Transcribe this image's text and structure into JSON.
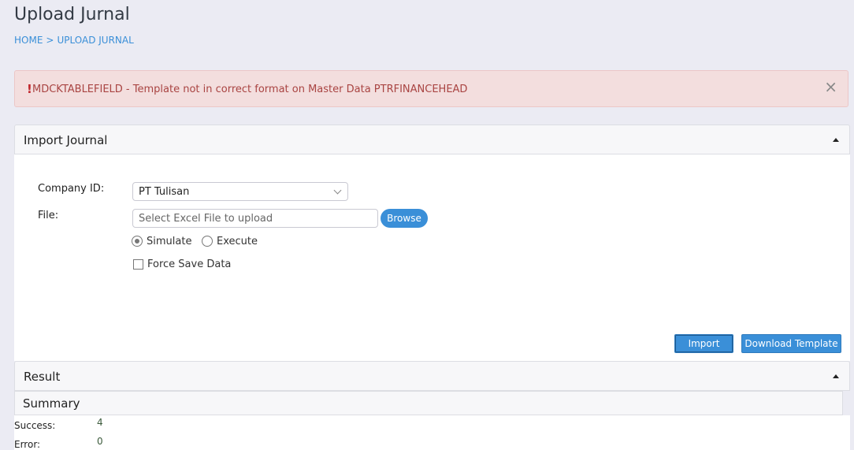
{
  "page": {
    "title": "Upload Jurnal",
    "breadcrumb": {
      "home": "HOME",
      "separator": ">",
      "current": "UPLOAD JURNAL"
    }
  },
  "alert": {
    "icon": "exclamation-icon",
    "mark": "!",
    "message": "MDCKTABLEFIELD - Template not in correct format on Master Data PTRFINANCEHEAD",
    "close": "×"
  },
  "import_panel": {
    "title": "Import Journal",
    "company_label": "Company ID:",
    "company_value": "PT Tulisan",
    "file_label": "File:",
    "file_placeholder": "Select Excel File to upload",
    "browse_label": "Browse",
    "mode_options": [
      {
        "label": "Simulate",
        "selected": true
      },
      {
        "label": "Execute",
        "selected": false
      }
    ],
    "force_save_label": "Force Save Data",
    "force_save_checked": false,
    "import_button": "Import",
    "download_template_button": "Download Template"
  },
  "result_panel": {
    "title": "Result",
    "summary_title": "Summary",
    "success_label": "Success:",
    "success_value": "4",
    "error_label": "Error:",
    "error_value": "0"
  },
  "colors": {
    "accent": "#3a8fd8",
    "alert_bg": "#f3dede",
    "alert_text": "#a94442",
    "page_bg": "#ebebf3"
  }
}
